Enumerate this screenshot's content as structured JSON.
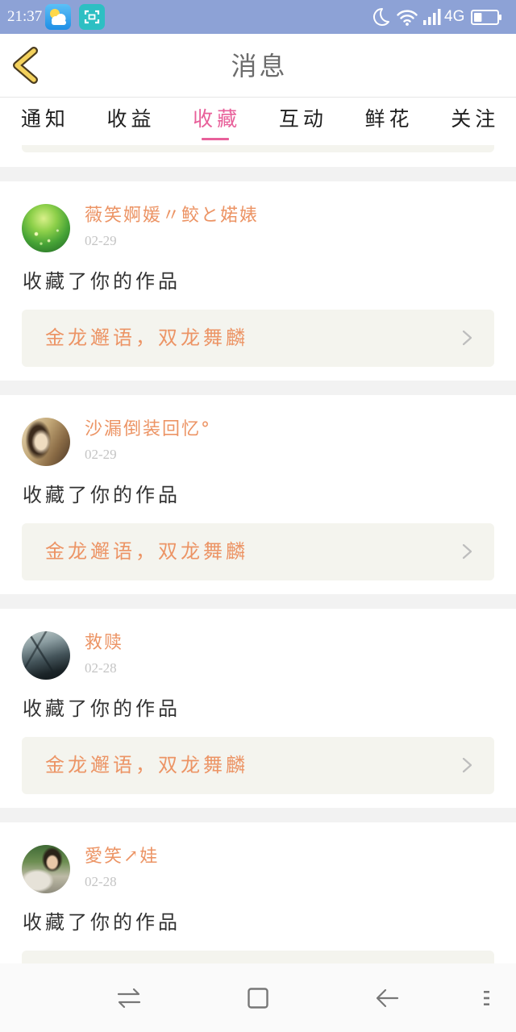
{
  "theme": {
    "status_bar": "#8da2d6",
    "accent": "#e8609a",
    "link_text": "#ec9465",
    "link_background": "#f4f4ee"
  },
  "status_bar": {
    "time": "21:37",
    "network_label": "4G",
    "battery_level": 0.35,
    "icons": [
      "weather-app-icon",
      "scan-app-icon",
      "moon-icon",
      "wifi-icon",
      "signal-icon",
      "battery-icon"
    ]
  },
  "header": {
    "title": "消息",
    "back_icon": "chevron-left-icon"
  },
  "tabs": {
    "items": [
      {
        "label": "通知",
        "active": false
      },
      {
        "label": "收益",
        "active": false
      },
      {
        "label": "收藏",
        "active": true
      },
      {
        "label": "互动",
        "active": false
      },
      {
        "label": "鲜花",
        "active": false
      },
      {
        "label": "关注",
        "active": false
      }
    ]
  },
  "notifications": [
    {
      "user_name": "薇笑婀媛〃鲛と婼婊",
      "date": "02-29",
      "action_text": "收藏了你的作品",
      "work_title": "金龙邂语，双龙舞麟",
      "link_icon": "chevron-right-icon"
    },
    {
      "user_name": "沙漏倒装回忆°",
      "date": "02-29",
      "action_text": "收藏了你的作品",
      "work_title": "金龙邂语，双龙舞麟",
      "link_icon": "chevron-right-icon"
    },
    {
      "user_name": "救赎",
      "date": "02-28",
      "action_text": "收藏了你的作品",
      "work_title": "金龙邂语，双龙舞麟",
      "link_icon": "chevron-right-icon"
    },
    {
      "user_name": "愛笑↗娃",
      "date": "02-28",
      "action_text": "收藏了你的作品"
    }
  ],
  "nav_bar": {
    "icons": [
      "switch-apps-icon",
      "home-square-icon",
      "back-arrow-icon",
      "menu-dots-icon"
    ]
  }
}
